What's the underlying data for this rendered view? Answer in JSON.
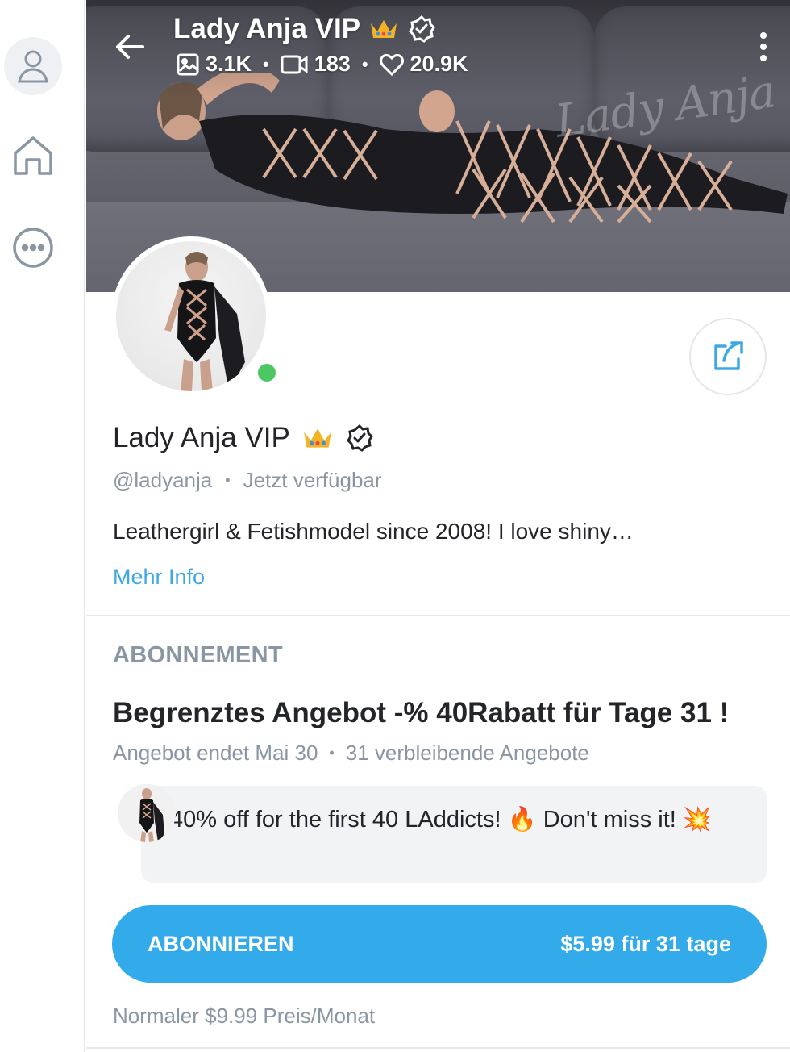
{
  "rail": {
    "items": [
      {
        "icon": "user-icon"
      },
      {
        "icon": "home-icon"
      },
      {
        "icon": "more-dots-icon"
      }
    ]
  },
  "cover": {
    "title": "Lady Anja VIP",
    "watermark": "Lady Anja",
    "stats": {
      "photos": "3.1K",
      "videos": "183",
      "likes": "20.9K"
    }
  },
  "profile": {
    "name": "Lady Anja VIP",
    "handle": "@ladyanja",
    "status_separator": "•",
    "status": "Jetzt verfügbar",
    "bio": "Leathergirl & Fetishmodel since 2008! I love shiny…",
    "more_info": "Mehr Info"
  },
  "subscription": {
    "heading": "ABONNEMENT",
    "promo_title": "Begrenztes Angebot -% 40Rabatt für Tage 31 !",
    "offer_ends": "Angebot endet Mai 30",
    "separator": "•",
    "remaining": "31 verbleibende Angebote",
    "message": "40% off for the first 40 LAddicts! 🔥 Don't miss it! 💥",
    "button_label": "ABONNIEREN",
    "button_price": "$5.99 für 31 tage",
    "normal_price": "Normaler $9.99 Preis/Monat"
  },
  "colors": {
    "accent": "#33aaea",
    "link": "#3ea8e6",
    "muted_text": "#8a96a3",
    "online": "#4cc764",
    "crown": "#f5b324"
  }
}
